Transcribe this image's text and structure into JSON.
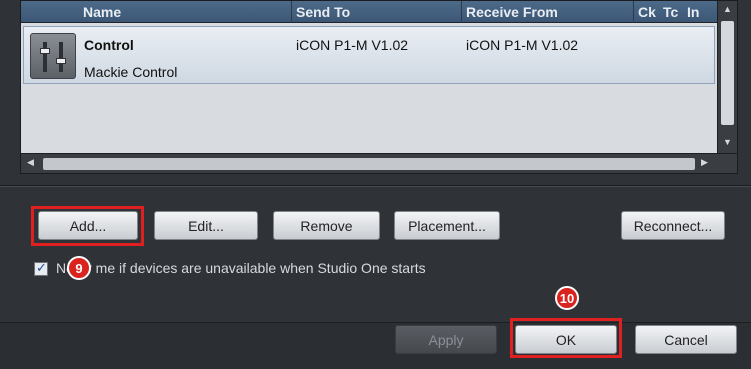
{
  "list": {
    "columns": [
      "Name",
      "Send To",
      "Receive From",
      "Ck",
      "Tc",
      "In"
    ],
    "rows": [
      {
        "name": "Control",
        "subtitle": "Mackie Control",
        "send_to": "iCON P1-M V1.02",
        "receive_from": "iCON P1-M V1.02",
        "icon": "device-fader-icon"
      }
    ]
  },
  "buttons": {
    "add": "Add...",
    "edit": "Edit...",
    "remove": "Remove",
    "placement": "Placement...",
    "reconnect": "Reconnect...",
    "apply": "Apply",
    "ok": "OK",
    "cancel": "Cancel"
  },
  "notify": {
    "checked": true,
    "label": "Notify me if devices are unavailable when Studio One starts"
  },
  "annotations": {
    "step_add": "9",
    "step_ok": "10",
    "highlight_color": "#e02020"
  }
}
